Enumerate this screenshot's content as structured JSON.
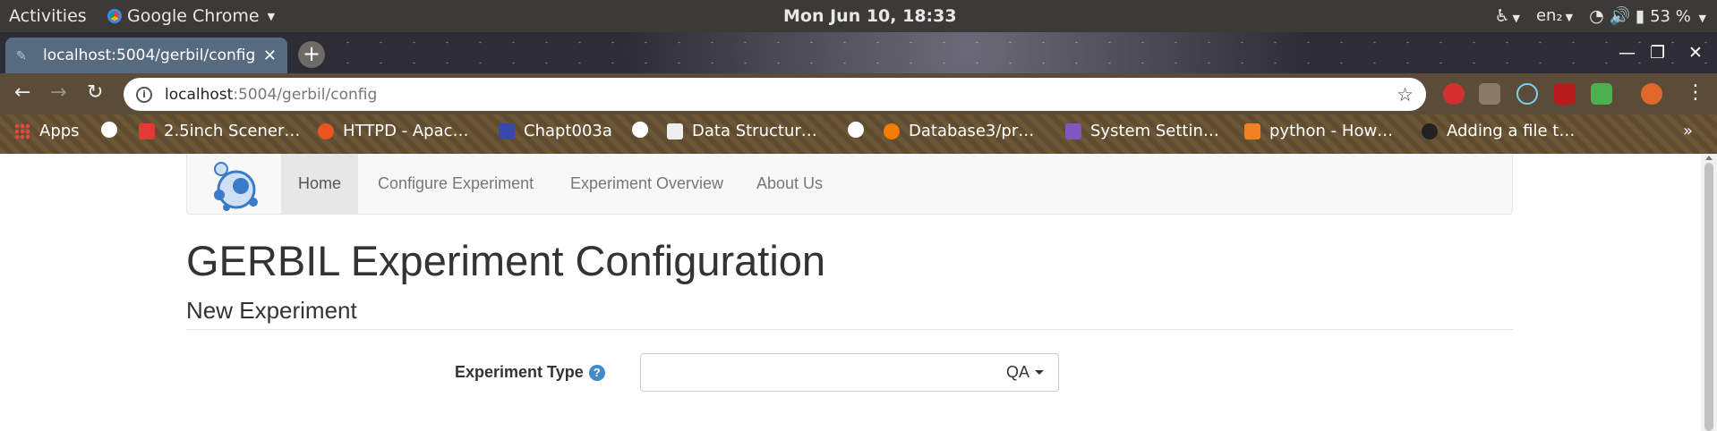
{
  "system_bar": {
    "activities": "Activities",
    "app_name": "Google Chrome",
    "clock": "Mon Jun 10, 18:33",
    "keyboard": "en₂",
    "battery": "53 %"
  },
  "browser": {
    "tab_title": "localhost:5004/gerbil/config",
    "url_host": "localhost",
    "url_path": ":5004/gerbil/config",
    "bookmarks": [
      "Apps",
      "2.5inch Scener…",
      "HTTPD - Apac…",
      "Chapt003a",
      "Data Structur…",
      "Database3/pr…",
      "System Settin…",
      "python - How…",
      "Adding a file t…"
    ],
    "overflow": "»"
  },
  "page": {
    "nav": {
      "items": [
        "Home",
        "Configure Experiment",
        "Experiment Overview",
        "About Us"
      ],
      "active": "Home"
    },
    "title": "GERBIL Experiment Configuration",
    "subtitle": "New Experiment",
    "form": {
      "experiment_type_label": "Experiment Type",
      "help_glyph": "?",
      "experiment_type_value": "QA"
    }
  },
  "colors": {
    "accent": "#428bca",
    "navbar_bg": "#f8f8f8",
    "active_nav_bg": "#e7e7e7"
  }
}
